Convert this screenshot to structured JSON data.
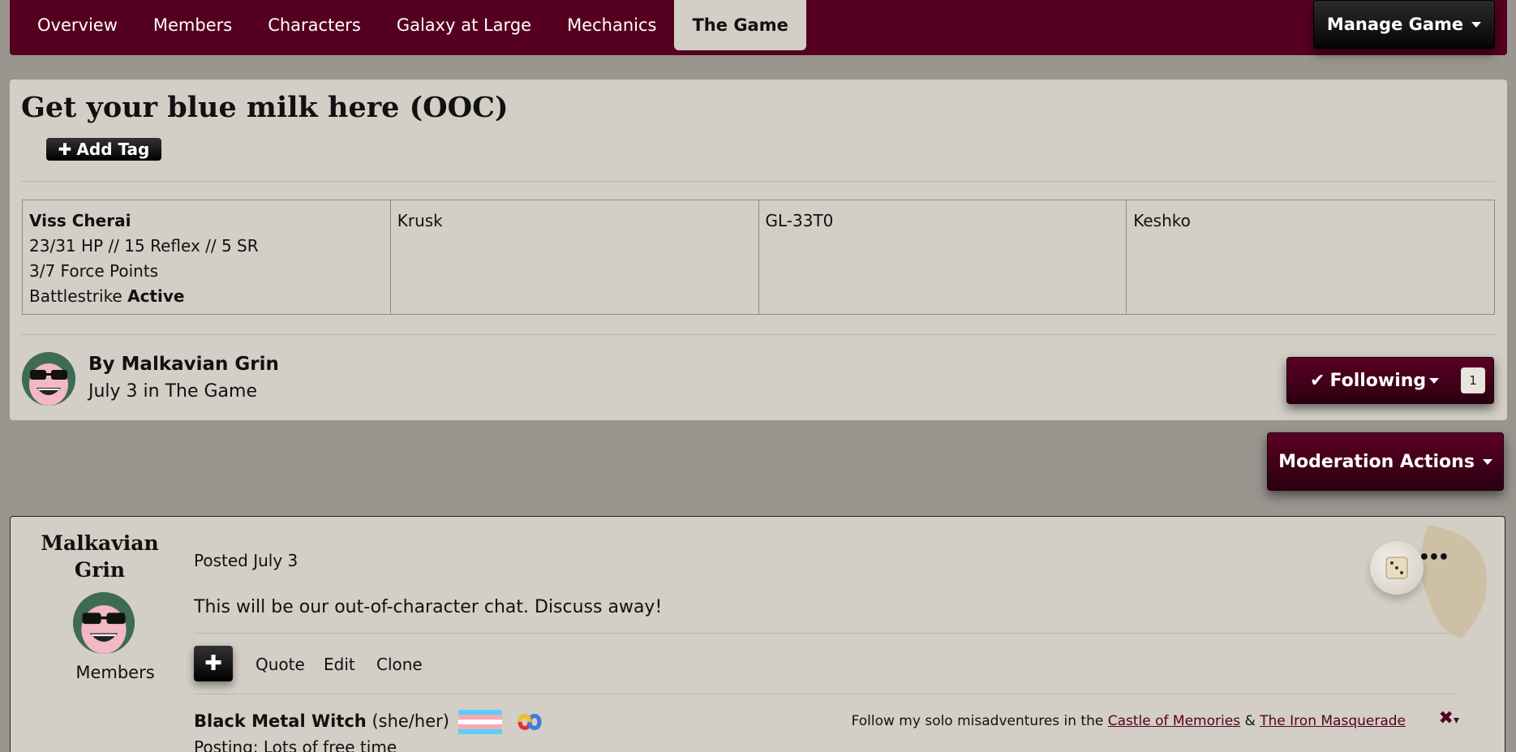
{
  "nav": {
    "items": [
      "Overview",
      "Members",
      "Characters",
      "Galaxy at Large",
      "Mechanics",
      "The Game"
    ],
    "active": "The Game",
    "manage_label": "Manage Game"
  },
  "topic": {
    "title": "Get your blue milk here (OOC)",
    "add_tag_label": "Add Tag"
  },
  "characters": [
    {
      "name": "Viss Cherai",
      "line1": "23/31 HP // 15 Reflex // 5 SR",
      "line2": "3/7 Force Points",
      "line3_prefix": "Battlestrike ",
      "line3_bold": "Active"
    },
    {
      "name": "Krusk"
    },
    {
      "name": "GL-33T0"
    },
    {
      "name": "Keshko"
    }
  ],
  "author": {
    "by": "By Malkavian Grin",
    "date": "July 3 in The Game"
  },
  "following": {
    "label": "Following",
    "count": "1"
  },
  "moderation_label": "Moderation Actions",
  "post": {
    "poster_name": "Malkavian Grin",
    "poster_group": "Members",
    "posted": "Posted July 3",
    "body": "This will be our out-of-character chat. Discuss away!",
    "actions": [
      "Quote",
      "Edit",
      "Clone"
    ],
    "signature": {
      "name_bold": "Black Metal Witch",
      "pronouns": " (she/her)",
      "line2": "Posting: Lots of free time",
      "follow_text": "Follow my solo misadventures in the ",
      "link1": "Castle of Memories",
      "amp": " & ",
      "link2": "The Iron Masquerade"
    }
  },
  "colors": {
    "brand": "#560021",
    "panel": "#d3cec6",
    "page_bg": "#9a958f"
  },
  "icons": [
    "caret-down-icon",
    "plus-icon",
    "check-icon",
    "ellipsis-icon",
    "dice-icon",
    "close-icon",
    "trans-flag-icon",
    "infinity-icon"
  ]
}
